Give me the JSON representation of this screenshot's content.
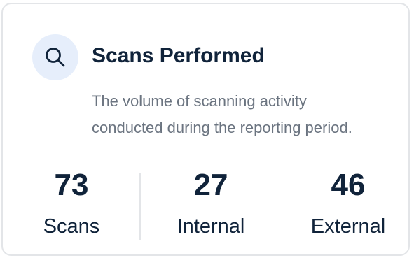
{
  "card": {
    "icon": "search-icon",
    "title": "Scans Performed",
    "description_lines": [
      "The volume of scanning activity",
      "conducted during the reporting period."
    ]
  },
  "stats": [
    {
      "value": "73",
      "label": "Scans"
    },
    {
      "value": "27",
      "label": "Internal"
    },
    {
      "value": "46",
      "label": "External"
    }
  ],
  "colors": {
    "title": "#10233a",
    "description": "#6b7480",
    "icon_background": "#e6eefb",
    "border": "#e3e5e8"
  }
}
